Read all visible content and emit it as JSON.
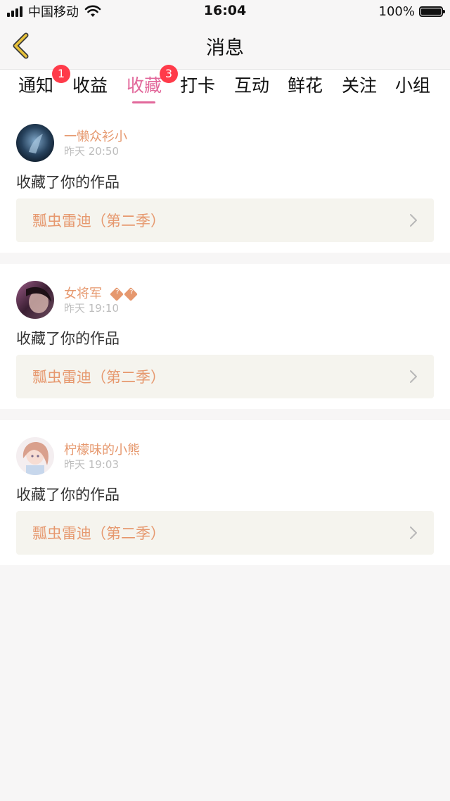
{
  "status_bar": {
    "carrier": "中国移动",
    "time": "16:04",
    "battery": "100%",
    "signal_icon": "signal-icon",
    "wifi_icon": "wifi-icon",
    "battery_icon": "battery-icon"
  },
  "nav": {
    "title": "消息",
    "back_icon": "chevron-left-icon"
  },
  "tabs": [
    {
      "label": "通知",
      "badge": "1",
      "active": false
    },
    {
      "label": "收益",
      "badge": "",
      "active": false
    },
    {
      "label": "收藏",
      "badge": "3",
      "active": true
    },
    {
      "label": "打卡",
      "badge": "",
      "active": false
    },
    {
      "label": "互动",
      "badge": "",
      "active": false
    },
    {
      "label": "鲜花",
      "badge": "",
      "active": false
    },
    {
      "label": "关注",
      "badge": "",
      "active": false
    },
    {
      "label": "小组",
      "badge": "",
      "active": false
    }
  ],
  "items": [
    {
      "user_name": "一懒众衫小",
      "time": "昨天 20:50",
      "action": "收藏了你的作品",
      "work_title": "瓢虫雷迪（第二季）",
      "name_icons": false
    },
    {
      "user_name": "女将军",
      "time": "昨天 19:10",
      "action": "收藏了你的作品",
      "work_title": "瓢虫雷迪（第二季）",
      "name_icons": true
    },
    {
      "user_name": "柠檬味的小熊",
      "time": "昨天 19:03",
      "action": "收藏了你的作品",
      "work_title": "瓢虫雷迪（第二季）",
      "name_icons": false
    }
  ],
  "colors": {
    "accent_pink": "#e2689b",
    "name_orange": "#e6986e",
    "badge_red": "#ff3b4a",
    "back_yellow": "#e8c23a"
  }
}
